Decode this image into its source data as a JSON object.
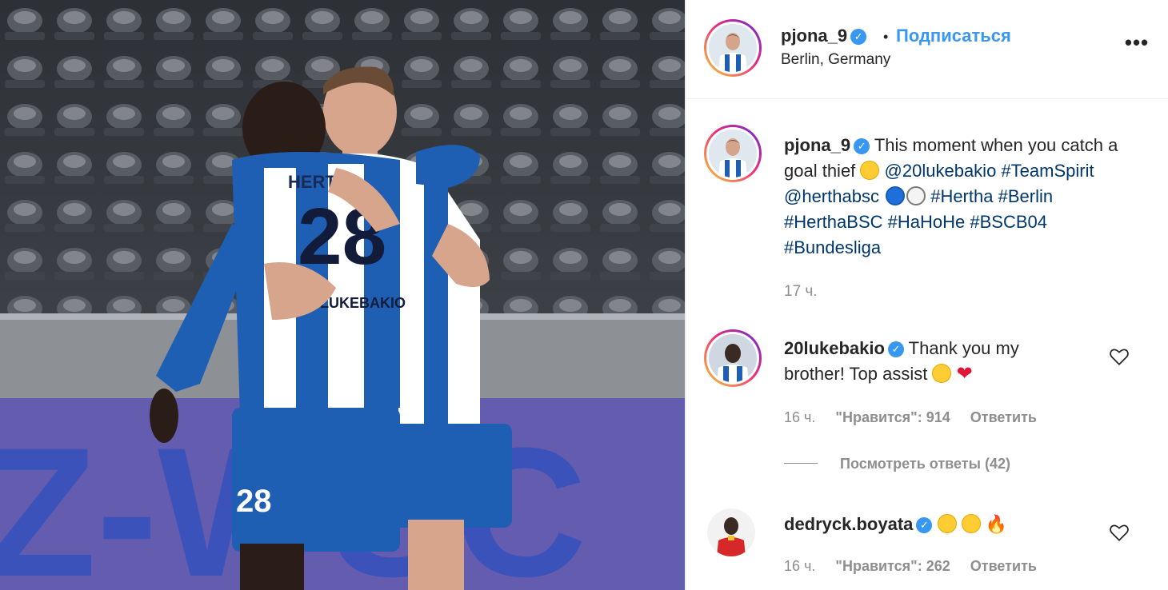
{
  "post": {
    "username": "pjona_9",
    "separator": "•",
    "follow_label": "Подписаться",
    "location": "Berlin, Germany",
    "more_icon": "more-horizontal-icon"
  },
  "caption": {
    "username": "pjona_9",
    "text_1": "This moment when you catch a goal thief",
    "mention_1": "@20lukebakio",
    "tag_teamspirit": "#TeamSpirit",
    "mention_2": "@herthabsc",
    "tag_hertha": "#Hertha",
    "tag_berlin": "#Berlin",
    "tag_herthabsc": "#HerthaBSC",
    "tag_hahohe": "#HaHoHe",
    "tag_bscb04": "#BSCB04",
    "tag_bundesliga": "#Bundesliga",
    "time": "17 ч."
  },
  "comments": [
    {
      "username": "20lukebakio",
      "text": "Thank you my brother! Top assist",
      "time": "16 ч.",
      "likes": "\"Нравится\": 914",
      "reply_label": "Ответить",
      "view_replies": "Посмотреть ответы (42)"
    },
    {
      "username": "dedryck.boyata",
      "time": "16 ч.",
      "likes": "\"Нравится\": 262",
      "reply_label": "Ответить"
    }
  ],
  "colors": {
    "accent": "#3897f0",
    "link": "#00376b",
    "muted": "#8e8e8e",
    "hertha_blue": "#1e5fb4"
  }
}
